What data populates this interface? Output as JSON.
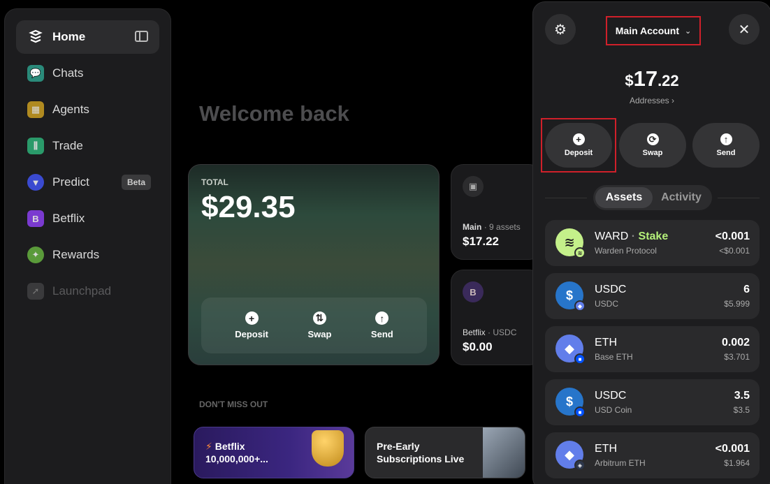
{
  "sidebar": {
    "items": [
      {
        "label": "Home",
        "icon": "logo-icon"
      },
      {
        "label": "Chats",
        "icon": "chat-icon"
      },
      {
        "label": "Agents",
        "icon": "grid-icon"
      },
      {
        "label": "Trade",
        "icon": "candles-icon"
      },
      {
        "label": "Predict",
        "icon": "shield-icon",
        "badge": "Beta"
      },
      {
        "label": "Betflix",
        "icon": "betflix-icon"
      },
      {
        "label": "Rewards",
        "icon": "rewards-icon"
      },
      {
        "label": "Launchpad",
        "icon": "rocket-icon"
      }
    ]
  },
  "main": {
    "welcome": "Welcome back",
    "total": {
      "label": "TOTAL",
      "amount": "$29.35",
      "actions": [
        "Deposit",
        "Swap",
        "Send"
      ]
    },
    "accounts": [
      {
        "name": "Main",
        "sub": "9 assets",
        "balance": "$17.22"
      },
      {
        "name": "Betflix",
        "sub": "USDC",
        "balance": "$0.00"
      }
    ],
    "dont_miss": "DON'T MISS OUT",
    "promos": [
      {
        "line1": "Betflix",
        "line2": "10,000,000+..."
      },
      {
        "line1": "Pre-Early",
        "line2": "Subscriptions Live"
      }
    ]
  },
  "wallet": {
    "account": "Main Account",
    "balance": {
      "currency": "$",
      "int": "17",
      "dec": ".22"
    },
    "addresses": "Addresses",
    "actions": [
      "Deposit",
      "Swap",
      "Send"
    ],
    "tabs": [
      "Assets",
      "Activity"
    ],
    "assets": [
      {
        "name": "WARD",
        "stake": "Stake",
        "desc": "Warden Protocol",
        "amount": "<0.001",
        "usd": "<$0.001"
      },
      {
        "name": "USDC",
        "desc": "USDC",
        "amount": "6",
        "usd": "$5.999"
      },
      {
        "name": "ETH",
        "desc": "Base ETH",
        "amount": "0.002",
        "usd": "$3.701"
      },
      {
        "name": "USDC",
        "desc": "USD Coin",
        "amount": "3.5",
        "usd": "$3.5"
      },
      {
        "name": "ETH",
        "desc": "Arbitrum ETH",
        "amount": "<0.001",
        "usd": "$1.964"
      }
    ]
  },
  "colors": {
    "accent": "#b4f07a",
    "highlight": "#d0202a",
    "usdc": "#2775ca",
    "eth": "#627eea"
  }
}
